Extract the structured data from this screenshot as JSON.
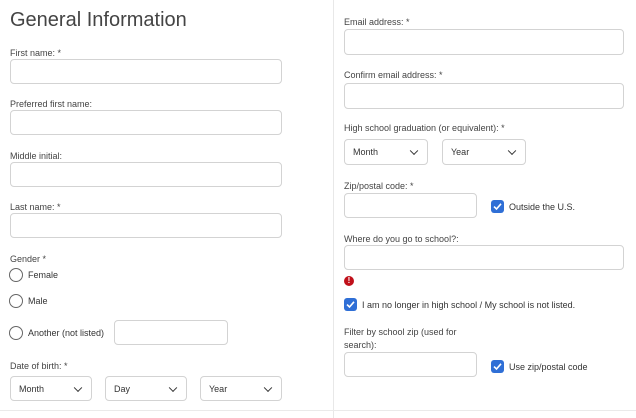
{
  "title": "General Information",
  "left": {
    "first_name_label": "First name: *",
    "preferred_first_name_label": "Preferred first name:",
    "middle_initial_label": "Middle initial:",
    "last_name_label": "Last name: *",
    "gender_label": "Gender *",
    "gender_options": [
      "Female",
      "Male",
      "Another (not listed)"
    ],
    "dob_label": "Date of birth: *",
    "dob_month": "Month",
    "dob_day": "Day",
    "dob_year": "Year"
  },
  "right": {
    "email_label": "Email address: *",
    "confirm_email_label": "Confirm email address: *",
    "hs_grad_label": "High school graduation (or equivalent): *",
    "hs_month": "Month",
    "hs_year": "Year",
    "zip_label": "Zip/postal code: *",
    "outside_us_label": "Outside the U.S.",
    "outside_us_checked": true,
    "school_label": "Where do you go to school?:",
    "error_icon_glyph": "!",
    "no_longer_label": "I am no longer in high school / My school is not listed.",
    "no_longer_checked": true,
    "filter_zip_label_line1": "Filter by school zip (used for",
    "filter_zip_label_line2": "search):",
    "use_zip_label": "Use zip/postal code",
    "use_zip_checked": true
  },
  "colors": {
    "accent": "#2f6fd6",
    "error": "#c0101a",
    "border": "#d3d3d3"
  }
}
